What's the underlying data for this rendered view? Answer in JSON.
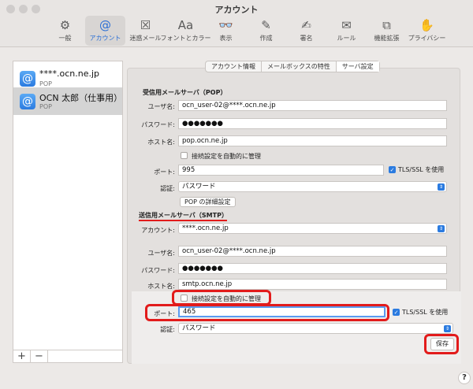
{
  "window": {
    "title": "アカウント"
  },
  "toolbar": {
    "items": [
      {
        "label": "一般",
        "icon": "gear-icon",
        "glyph": "⚙"
      },
      {
        "label": "アカウント",
        "icon": "at-sign-icon",
        "glyph": "@"
      },
      {
        "label": "迷惑メール",
        "icon": "junk-mail-icon",
        "glyph": "☒"
      },
      {
        "label": "フォントとカラー",
        "icon": "font-icon",
        "glyph": "Aa"
      },
      {
        "label": "表示",
        "icon": "glasses-icon",
        "glyph": "👓"
      },
      {
        "label": "作成",
        "icon": "compose-icon",
        "glyph": "✎"
      },
      {
        "label": "署名",
        "icon": "signature-icon",
        "glyph": "✍"
      },
      {
        "label": "ルール",
        "icon": "rules-icon",
        "glyph": "✉"
      },
      {
        "label": "機能拡張",
        "icon": "extensions-icon",
        "glyph": "⧉"
      },
      {
        "label": "プライバシー",
        "icon": "privacy-hand-icon",
        "glyph": "✋"
      }
    ]
  },
  "sidebar": {
    "accounts": [
      {
        "name": "****.ocn.ne.jp",
        "type": "POP"
      },
      {
        "name": "OCN 太郎（仕事用）",
        "type": "POP"
      }
    ],
    "add_label": "+",
    "remove_label": "−"
  },
  "tabs": [
    {
      "label": "アカウント情報"
    },
    {
      "label": "メールボックスの特性"
    },
    {
      "label": "サーバ設定"
    }
  ],
  "incoming": {
    "title": "受信用メールサーバ（POP）",
    "username_label": "ユーザ名:",
    "username": "ocn_user-02@****.ocn.ne.jp",
    "password_label": "パスワード:",
    "password": "●●●●●●●",
    "host_label": "ホスト名:",
    "host": "pop.ocn.ne.jp",
    "auto_manage_label": "接続設定を自動的に管理",
    "port_label": "ポート:",
    "port": "995",
    "tls_label": "TLS/SSL を使用",
    "auth_label": "認証:",
    "auth": "パスワード",
    "advanced_button": "POP の詳細設定"
  },
  "outgoing": {
    "title": "送信用メールサーバ（SMTP）",
    "account_label": "アカウント:",
    "account": "****.ocn.ne.jp",
    "username_label": "ユーザ名:",
    "username": "ocn_user-02@****.ocn.ne.jp",
    "password_label": "パスワード:",
    "password": "●●●●●●●",
    "host_label": "ホスト名:",
    "host": "smtp.ocn.ne.jp",
    "auto_manage_label": "接続設定を自動的に管理",
    "port_label": "ポート:",
    "port": "465",
    "tls_label": "TLS/SSL を使用",
    "auth_label": "認証:",
    "auth": "パスワード"
  },
  "save_button": "保存",
  "help": "?",
  "colors": {
    "accent": "#2b7be0",
    "highlight": "#e21b1b"
  }
}
